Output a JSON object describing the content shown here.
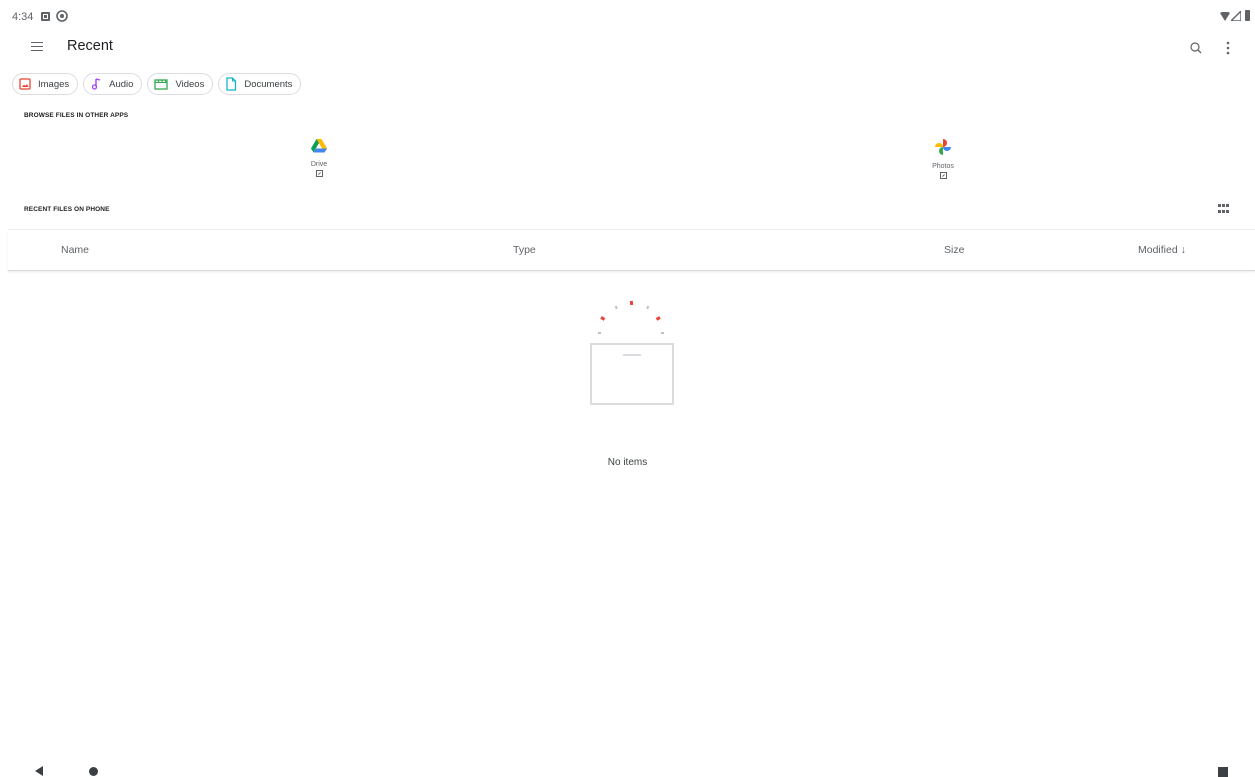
{
  "status_bar": {
    "time": "4:34"
  },
  "toolbar": {
    "title": "Recent"
  },
  "filter_chips": [
    {
      "label": "Images",
      "icon": "image-icon",
      "color": "#ea4335"
    },
    {
      "label": "Audio",
      "icon": "music-note-icon",
      "color": "#a142f4"
    },
    {
      "label": "Videos",
      "icon": "movie-icon",
      "color": "#34a853"
    },
    {
      "label": "Documents",
      "icon": "document-icon",
      "color": "#12b5cb"
    }
  ],
  "other_apps": {
    "heading": "BROWSE FILES IN OTHER APPS",
    "apps": [
      {
        "label": "Drive",
        "icon": "google-drive-icon"
      },
      {
        "label": "Photos",
        "icon": "google-photos-icon"
      }
    ]
  },
  "recent_files": {
    "heading": "RECENT FILES ON PHONE",
    "columns": {
      "name": "Name",
      "type": "Type",
      "size": "Size",
      "modified": "Modified ↓"
    },
    "empty_message": "No items"
  },
  "colors": {
    "accent_red": "#ea4335",
    "text_secondary": "#5f6368",
    "divider": "#dadce0"
  }
}
